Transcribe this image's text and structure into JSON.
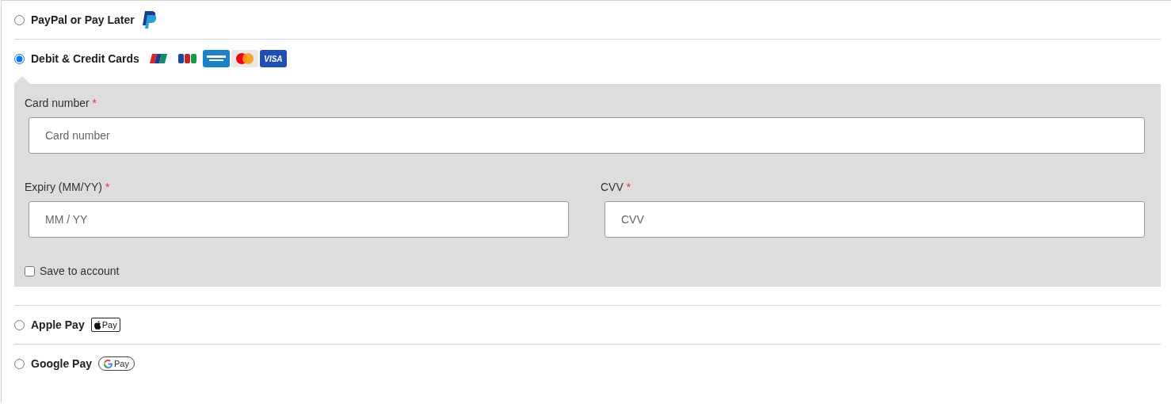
{
  "methods": [
    {
      "kind": "paypal",
      "label": "PayPal or Pay Later",
      "selected": false
    },
    {
      "kind": "cards",
      "label": "Debit & Credit Cards",
      "selected": true,
      "brands": [
        {
          "kind": "unionpay"
        },
        {
          "kind": "jcb"
        },
        {
          "kind": "amex"
        },
        {
          "kind": "mastercard"
        },
        {
          "kind": "visa",
          "text": "VISA"
        }
      ],
      "form": {
        "card_number": {
          "label": "Card number",
          "required": "*",
          "placeholder": "Card number"
        },
        "expiry": {
          "label": "Expiry (MM/YY)",
          "required": "*",
          "placeholder": "MM / YY"
        },
        "cvv": {
          "label": "CVV",
          "required": "*",
          "placeholder": "CVV"
        },
        "save": {
          "label": "Save to account",
          "checked": false
        }
      }
    },
    {
      "kind": "applepay",
      "label": "Apple Pay",
      "selected": false,
      "badge": "Pay"
    },
    {
      "kind": "googlepay",
      "label": "Google Pay",
      "selected": false,
      "badge": "Pay"
    }
  ]
}
